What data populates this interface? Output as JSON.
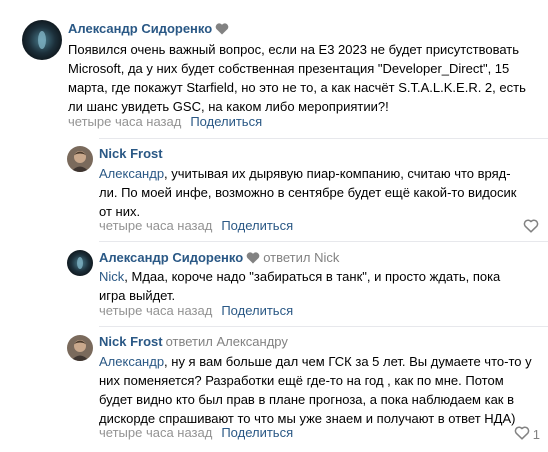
{
  "comments": [
    {
      "author": "Александр Сидоренко",
      "text": "Появился очень важный вопрос, если на Е3 2023 не будет присутствовать\nMicrosoft, да у них будет собственная презентация \"Developer_Direct\", 15\nмарта, где покажут Starfield, но это не то, а как насчёт S.T.A.L.K.E.R. 2, есть\nли шанс увидеть GSC, на каком либо мероприятии?!",
      "time": "четыре часа назад",
      "share": "Поделиться"
    },
    {
      "author": "Nick Frost",
      "mention": "Александр",
      "text": ", учитывая их дырявую пиар-компанию, считаю что вряд-\nли. По моей инфе, возможно в сентябре будет ещё какой-то видосик\nот них.",
      "time": "четыре часа назад",
      "share": "Поделиться"
    },
    {
      "author": "Александр Сидоренко",
      "replied": "ответил",
      "replied_to": "Nick",
      "mention": "Nick",
      "text": ", Мдаа, короче надо \"забираться в танк\", и просто ждать, пока\nигра выйдет.",
      "time": "четыре часа назад",
      "share": "Поделиться"
    },
    {
      "author": "Nick Frost",
      "replied": "ответил",
      "replied_to": "Александру",
      "mention": "Александр",
      "text": ", ну я вам больше дал чем ГСК за 5 лет. Вы думаете что-то у\nних поменяется? Разработки ещё где-то на год , как по мне. Потом\nбудет видно кто был прав в плане прогноза, а пока наблюдаем как в\nдискорде спрашивают то что мы уже знаем и получают в ответ НДА)",
      "time": "четыре часа назад",
      "share": "Поделиться",
      "likes": "1"
    }
  ],
  "icons": {
    "heart": "heart-icon",
    "like": "like-heart-icon"
  },
  "colors": {
    "link": "#2a5885",
    "meta": "#939393",
    "divider": "#e7e8ec",
    "heart_gray": "#828282"
  }
}
